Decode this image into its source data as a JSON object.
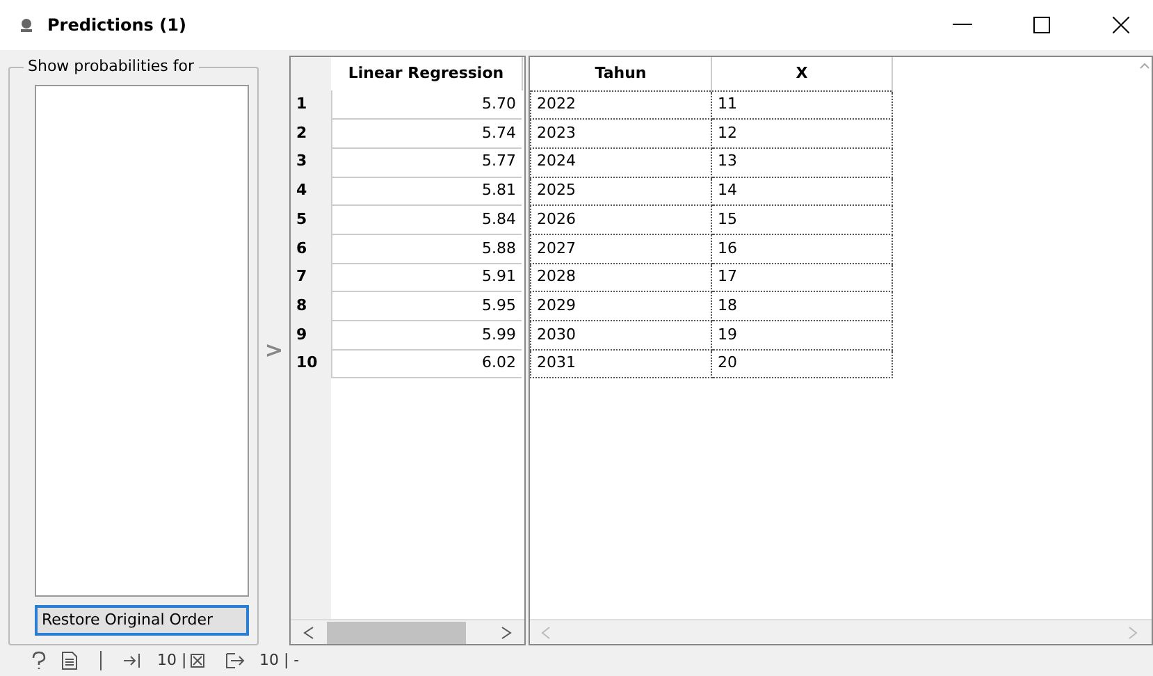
{
  "window": {
    "title": "Predictions (1)"
  },
  "left_panel": {
    "group_title": "Show probabilities for",
    "button": "Restore Original Order"
  },
  "splitter": {
    "symbol": ">"
  },
  "predictions_table": {
    "columns": [
      "Linear Regression"
    ],
    "rows": [
      {
        "index": "1",
        "value": "5.70"
      },
      {
        "index": "2",
        "value": "5.74"
      },
      {
        "index": "3",
        "value": "5.77"
      },
      {
        "index": "4",
        "value": "5.81"
      },
      {
        "index": "5",
        "value": "5.84"
      },
      {
        "index": "6",
        "value": "5.88"
      },
      {
        "index": "7",
        "value": "5.91"
      },
      {
        "index": "8",
        "value": "5.95"
      },
      {
        "index": "9",
        "value": "5.99"
      },
      {
        "index": "10",
        "value": "6.02"
      }
    ]
  },
  "data_table": {
    "columns": [
      "Tahun",
      "X"
    ],
    "rows": [
      [
        "2022",
        "11"
      ],
      [
        "2023",
        "12"
      ],
      [
        "2024",
        "13"
      ],
      [
        "2025",
        "14"
      ],
      [
        "2026",
        "15"
      ],
      [
        "2027",
        "16"
      ],
      [
        "2028",
        "17"
      ],
      [
        "2029",
        "18"
      ],
      [
        "2030",
        "19"
      ],
      [
        "2031",
        "20"
      ]
    ]
  },
  "status_bar": {
    "input_count": "10 |",
    "output_count": "10 | -"
  }
}
